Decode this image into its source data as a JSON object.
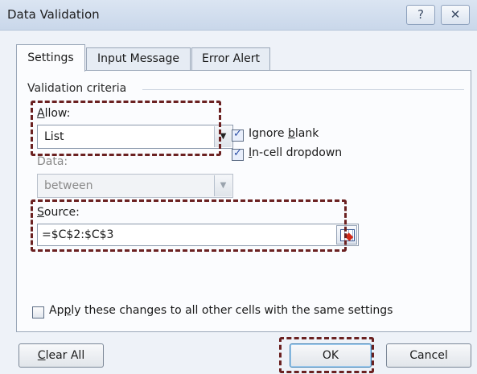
{
  "window": {
    "title": "Data Validation",
    "help_glyph": "?",
    "close_glyph": "✕"
  },
  "tabs": [
    {
      "label": "Settings",
      "active": true
    },
    {
      "label": "Input Message",
      "active": false
    },
    {
      "label": "Error Alert",
      "active": false
    }
  ],
  "criteria": {
    "group_label": "Validation criteria",
    "allow": {
      "label_key": "A",
      "label_rest": "llow:",
      "value": "List"
    },
    "data": {
      "label": "Data:",
      "value": "between"
    },
    "ignore_blank": {
      "label_pre": "Ignore ",
      "label_key": "b",
      "label_post": "lank",
      "checked": true
    },
    "in_cell_dropdown": {
      "label_key": "I",
      "label_rest": "n-cell dropdown",
      "checked": true
    },
    "source": {
      "label_key": "S",
      "label_rest": "ource:",
      "value": "=$C$2:$C$3"
    }
  },
  "apply_all": {
    "label_pre": "Ap",
    "label_key": "p",
    "label_post": "ly these changes to all other cells with the same settings",
    "checked": false
  },
  "buttons": {
    "clear_key": "C",
    "clear_rest": "lear All",
    "ok": "OK",
    "cancel": "Cancel"
  },
  "colors": {
    "highlight_dash": "#6b2121",
    "accent": "#2b4ea6"
  },
  "icons": {
    "checkbox_check": "check-icon",
    "dropdown": "chevron-down-icon",
    "range_selector": "range-select-icon"
  }
}
